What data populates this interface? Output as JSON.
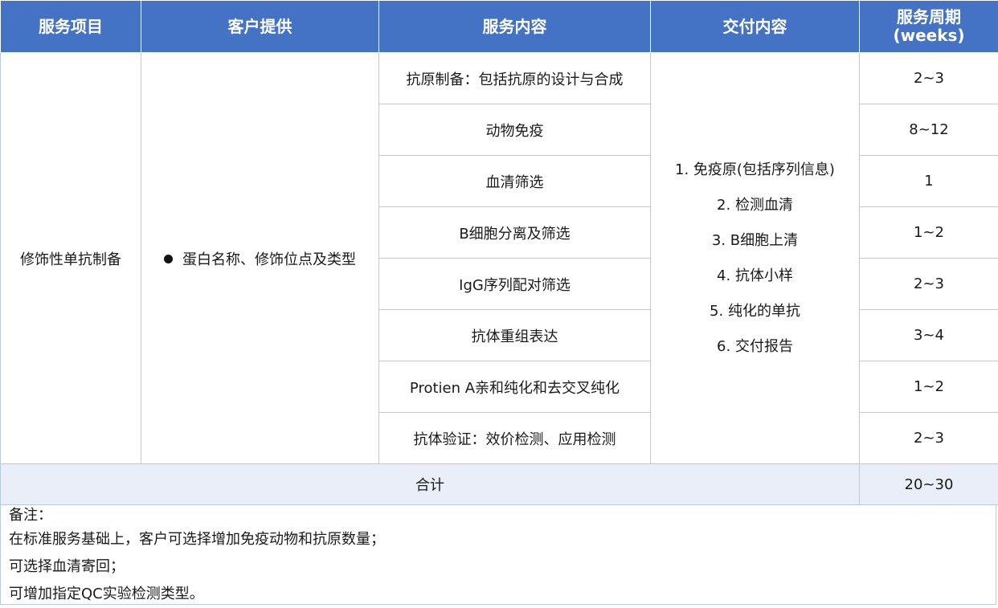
{
  "headers": [
    "服务项目",
    "客户提供",
    "服务内容",
    "交付内容",
    "服务周期\n(weeks)"
  ],
  "header_cycle_line1": "服务周期",
  "header_cycle_line2": "(weeks)",
  "service_item": "修饰性单抗制备",
  "customer_provides": "蛋白名称、修饰位点及类型",
  "rows": [
    {
      "content": "抗原制备：包括抗原的设计与合成",
      "cycle": "2~3"
    },
    {
      "content": "动物免疫",
      "cycle": "8~12"
    },
    {
      "content": "血清筛选",
      "cycle": "1"
    },
    {
      "content": "B细胞分离及筛选",
      "cycle": "1~2"
    },
    {
      "content": "IgG序列配对筛选",
      "cycle": "2~3"
    },
    {
      "content": "抗体重组表达",
      "cycle": "3~4"
    },
    {
      "content": "Protien A亲和纯化和去交叉纯化",
      "cycle": "1~2"
    },
    {
      "content": "抗体验证：效价检测、应用检测",
      "cycle": "2~3"
    }
  ],
  "deliverables": [
    "1. 免疫原(包括序列信息)",
    "2. 检测血清",
    "3. B细胞上清",
    "4. 抗体小样",
    "5. 纯化的单抗",
    "6. 交付报告"
  ],
  "total": {
    "label": "合计",
    "cycle": "20~30"
  },
  "notes": [
    "备注：",
    "在标准服务基础上，客户可选择增加免疫动物和抗原数量；",
    "可选择血清寄回；",
    "可增加指定QC实验检测类型。"
  ]
}
